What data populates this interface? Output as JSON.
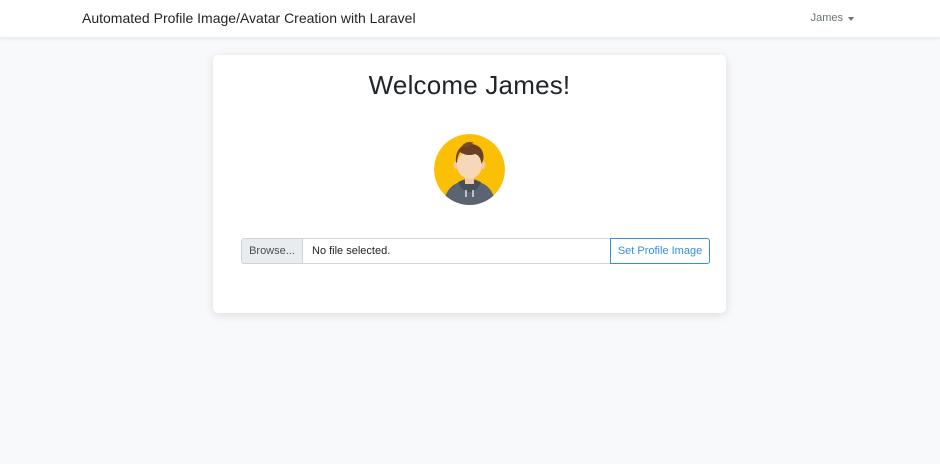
{
  "navbar": {
    "brand": "Automated Profile Image/Avatar Creation with Laravel",
    "user_name": "James"
  },
  "card": {
    "welcome": "Welcome James!",
    "avatar_icon": "user-avatar-icon",
    "upload": {
      "browse_label": "Browse...",
      "file_status": "No file selected.",
      "submit_label": "Set Profile Image"
    }
  },
  "colors": {
    "accent": "#3490dc",
    "avatar_bg": "#fbbf06",
    "page_bg": "#f8f9fb"
  }
}
